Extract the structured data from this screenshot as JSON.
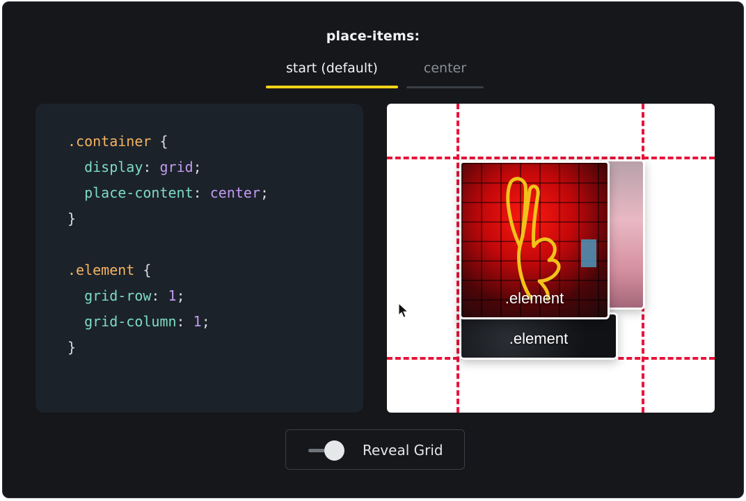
{
  "heading": "place-items:",
  "tabs": [
    {
      "label": "start (default)",
      "active": true
    },
    {
      "label": "center",
      "active": false
    }
  ],
  "code": {
    "container_selector": ".container",
    "display_prop": "display",
    "display_val": "grid",
    "place_content_prop": "place-content",
    "place_content_val": "center",
    "element_selector": ".element",
    "grid_row_prop": "grid-row",
    "grid_row_val": "1",
    "grid_column_prop": "grid-column",
    "grid_column_val": "1"
  },
  "preview": {
    "front_card_label": ".element",
    "back_card_label": ".element"
  },
  "toggle": {
    "label": "Reveal Grid",
    "on": true
  },
  "colors": {
    "accent": "#ffd319",
    "grid_line": "#e8143a",
    "selector": "#f5b463",
    "property": "#7ddcc4",
    "value": "#c39bf0"
  }
}
